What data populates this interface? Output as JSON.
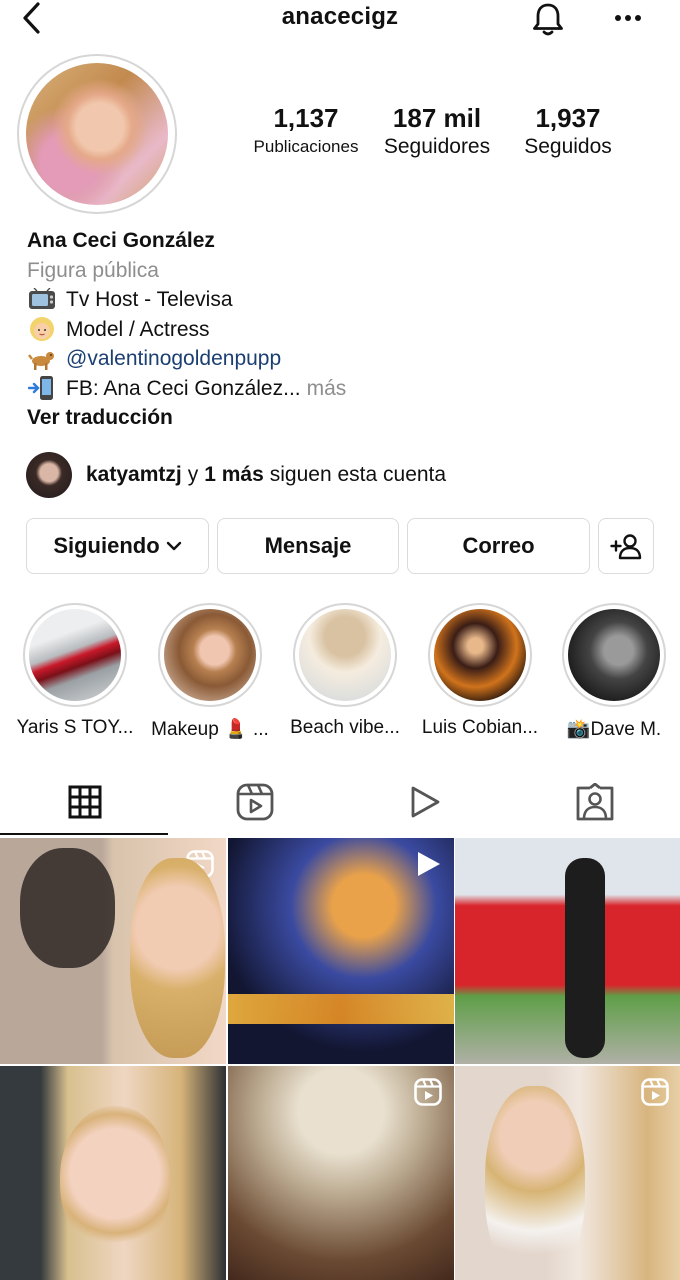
{
  "header": {
    "username": "anacecigz"
  },
  "stats": {
    "posts_value": "1,137",
    "posts_label": "Publicaciones",
    "followers_value": "187 mil",
    "followers_label": "Seguidores",
    "following_value": "1,937",
    "following_label": "Seguidos"
  },
  "bio": {
    "name": "Ana Ceci González",
    "category": "Figura pública",
    "lines": [
      {
        "emoji": "📺",
        "text": "Tv Host - Televisa"
      },
      {
        "emoji": "👱‍♀️",
        "text": "Model / Actress"
      },
      {
        "emoji": "🐕",
        "text": "@valentinogoldenpupp"
      },
      {
        "emoji": "📲",
        "text": "FB: Ana Ceci González..."
      }
    ],
    "more": "más",
    "translate": "Ver traducción"
  },
  "followed_by": {
    "user": "katyamtzj",
    "connector": "y",
    "others": "1 más",
    "suffix": "siguen esta cuenta"
  },
  "actions": {
    "following": "Siguiendo",
    "message": "Mensaje",
    "email": "Correo"
  },
  "highlights": [
    {
      "label": "Yaris S TOY..."
    },
    {
      "label": "Makeup 💄 ..."
    },
    {
      "label": "Beach vibe..."
    },
    {
      "label": "Luis Cobian..."
    },
    {
      "label": "📸Dave M."
    }
  ],
  "tabs": {
    "active": "grid",
    "items": [
      "grid-icon",
      "reels-icon",
      "video-icon",
      "tagged-icon"
    ]
  },
  "grid": {
    "posts": [
      {
        "type": "reel"
      },
      {
        "type": "video"
      },
      {
        "type": "photo"
      },
      {
        "type": "photo"
      },
      {
        "type": "reel"
      },
      {
        "type": "reel"
      }
    ]
  },
  "colors": {
    "link": "#1c3f72",
    "secondary_text": "#8e8e8e",
    "border": "#dbdbdb"
  }
}
